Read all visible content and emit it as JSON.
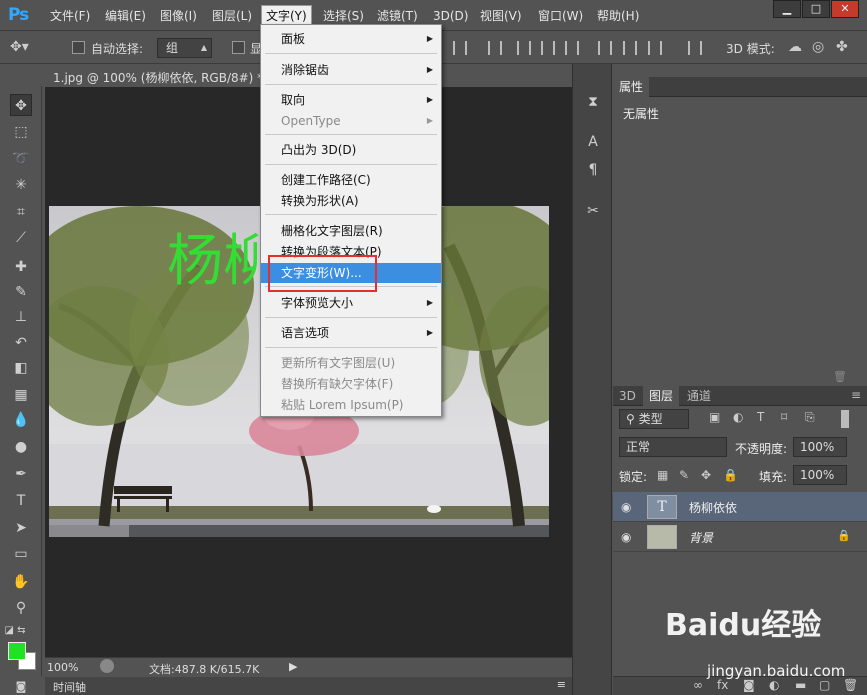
{
  "app": {
    "logo": "Ps"
  },
  "menubar": {
    "items": [
      "文件(F)",
      "编辑(E)",
      "图像(I)",
      "图层(L)",
      "文字(Y)",
      "选择(S)",
      "滤镜(T)",
      "3D(D)",
      "视图(V)",
      "窗口(W)",
      "帮助(H)"
    ],
    "active_index": 4
  },
  "options_bar": {
    "auto_select_label": "自动选择:",
    "auto_select_value": "组",
    "show_label": "显",
    "mode_3d_label": "3D 模式:"
  },
  "document": {
    "tab_title": "1.jpg @ 100% (杨柳依依, RGB/8#) *",
    "canvas_text": "杨柳",
    "zoom": "100%",
    "doc_info": "文档:487.8 K/615.7K"
  },
  "timeline": {
    "label": "时间轴"
  },
  "text_menu": {
    "items": [
      {
        "label": "面板",
        "submenu": true,
        "disabled": false
      },
      {
        "label": "消除锯齿",
        "submenu": true,
        "disabled": false
      },
      {
        "label": "取向",
        "submenu": true,
        "disabled": false
      },
      {
        "label": "OpenType",
        "submenu": true,
        "disabled": true
      },
      {
        "label": "凸出为 3D(D)",
        "submenu": false,
        "disabled": false
      },
      {
        "label": "创建工作路径(C)",
        "submenu": false,
        "disabled": false
      },
      {
        "label": "转换为形状(A)",
        "submenu": false,
        "disabled": false
      },
      {
        "label": "栅格化文字图层(R)",
        "submenu": false,
        "disabled": false
      },
      {
        "label": "转换为段落文本(P)",
        "submenu": false,
        "disabled": false
      },
      {
        "label": "文字变形(W)...",
        "submenu": false,
        "disabled": false,
        "highlighted": true
      },
      {
        "label": "字体预览大小",
        "submenu": true,
        "disabled": false
      },
      {
        "label": "语言选项",
        "submenu": true,
        "disabled": false
      },
      {
        "label": "更新所有文字图层(U)",
        "submenu": false,
        "disabled": true
      },
      {
        "label": "替换所有缺欠字体(F)",
        "submenu": false,
        "disabled": true
      },
      {
        "label": "粘贴 Lorem Ipsum(P)",
        "submenu": false,
        "disabled": true
      }
    ]
  },
  "properties_panel": {
    "tab": "属性",
    "empty_text": "无属性"
  },
  "layers_panel": {
    "tabs": [
      "3D",
      "图层",
      "通道"
    ],
    "active_tab": 1,
    "filter_label": "类型",
    "blend_mode": "正常",
    "opacity_label": "不透明度:",
    "opacity_value": "100%",
    "lock_label": "锁定:",
    "fill_label": "填充:",
    "fill_value": "100%",
    "layers": [
      {
        "name": "杨柳依依",
        "type": "text",
        "thumb_glyph": "T",
        "selected": true
      },
      {
        "name": "背景",
        "type": "image",
        "locked": true,
        "selected": false
      }
    ],
    "footer_fx": "fx"
  },
  "watermark": {
    "brand": "Baidu经验",
    "url": "jingyan.baidu.com"
  },
  "colors": {
    "foreground": "#22e022",
    "background": "#ffffff",
    "menu_highlight": "#3c8ee0",
    "annotation_box": "#e23030",
    "canvas_text": "#33dd33"
  }
}
